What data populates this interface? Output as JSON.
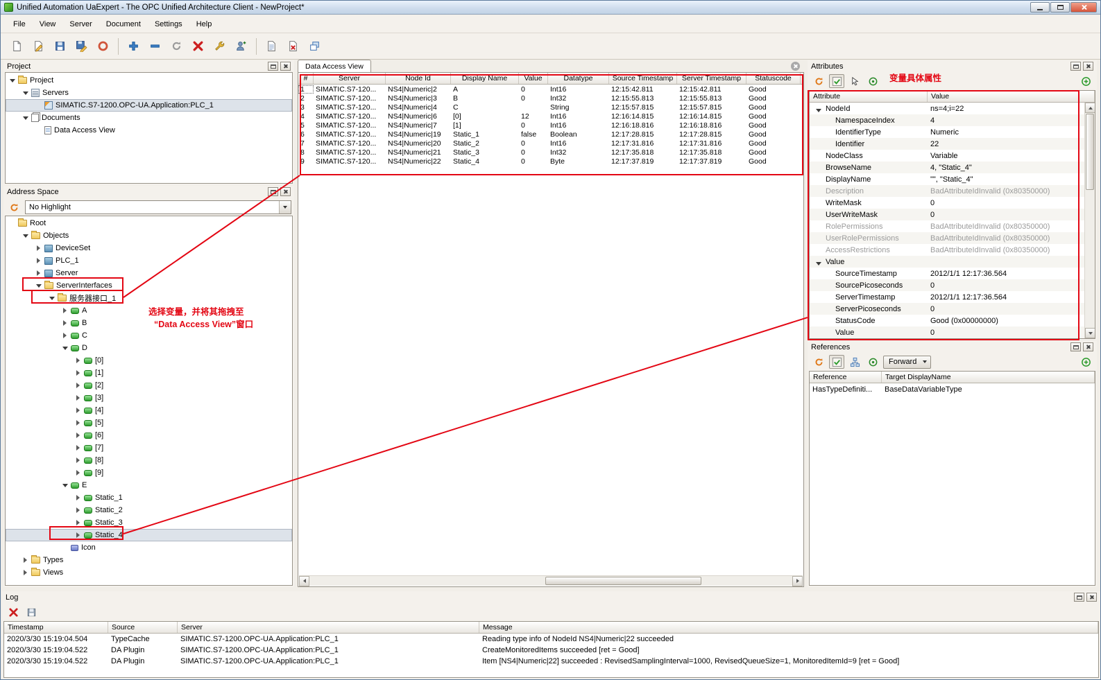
{
  "window": {
    "title": "Unified Automation UaExpert - The OPC Unified Architecture Client - NewProject*"
  },
  "menu": {
    "items": [
      "File",
      "View",
      "Server",
      "Document",
      "Settings",
      "Help"
    ]
  },
  "toolbar": {
    "icons": [
      "new-document",
      "open-document",
      "save",
      "save-as",
      "power-off",
      "add-server",
      "remove-server",
      "reconnect-server",
      "disconnect-server",
      "server-properties",
      "change-user",
      "add-document",
      "close-document",
      "window-layout"
    ]
  },
  "project_panel": {
    "title": "Project",
    "items": [
      {
        "level": 0,
        "exp": "open",
        "icon": "folder",
        "label": "Project"
      },
      {
        "level": 1,
        "exp": "open",
        "icon": "server",
        "label": "Servers"
      },
      {
        "level": 2,
        "exp": "none",
        "icon": "app",
        "label": "SIMATIC.S7-1200.OPC-UA.Application:PLC_1",
        "selected": true
      },
      {
        "level": 1,
        "exp": "open",
        "icon": "docs",
        "label": "Documents"
      },
      {
        "level": 2,
        "exp": "none",
        "icon": "doc",
        "label": "Data Access View"
      }
    ]
  },
  "address_space": {
    "title": "Address Space",
    "highlight_filter": "No Highlight",
    "items": [
      {
        "level": 0,
        "exp": "none",
        "icon": "folder",
        "label": "Root"
      },
      {
        "level": 1,
        "exp": "open",
        "icon": "folder",
        "label": "Objects"
      },
      {
        "level": 2,
        "exp": "closed",
        "icon": "cube",
        "label": "DeviceSet"
      },
      {
        "level": 2,
        "exp": "closed",
        "icon": "cube",
        "label": "PLC_1"
      },
      {
        "level": 2,
        "exp": "closed",
        "icon": "cube",
        "label": "Server"
      },
      {
        "level": 2,
        "exp": "open",
        "icon": "folder",
        "label": "ServerInterfaces"
      },
      {
        "level": 3,
        "exp": "open",
        "icon": "folder",
        "label": "服务器接口_1"
      },
      {
        "level": 4,
        "exp": "closed",
        "icon": "var",
        "label": "A"
      },
      {
        "level": 4,
        "exp": "closed",
        "icon": "var",
        "label": "B"
      },
      {
        "level": 4,
        "exp": "closed",
        "icon": "var",
        "label": "C"
      },
      {
        "level": 4,
        "exp": "open",
        "icon": "var",
        "label": "D"
      },
      {
        "level": 5,
        "exp": "closed",
        "icon": "var",
        "label": "[0]"
      },
      {
        "level": 5,
        "exp": "closed",
        "icon": "var",
        "label": "[1]"
      },
      {
        "level": 5,
        "exp": "closed",
        "icon": "var",
        "label": "[2]"
      },
      {
        "level": 5,
        "exp": "closed",
        "icon": "var",
        "label": "[3]"
      },
      {
        "level": 5,
        "exp": "closed",
        "icon": "var",
        "label": "[4]"
      },
      {
        "level": 5,
        "exp": "closed",
        "icon": "var",
        "label": "[5]"
      },
      {
        "level": 5,
        "exp": "closed",
        "icon": "var",
        "label": "[6]"
      },
      {
        "level": 5,
        "exp": "closed",
        "icon": "var",
        "label": "[7]"
      },
      {
        "level": 5,
        "exp": "closed",
        "icon": "var",
        "label": "[8]"
      },
      {
        "level": 5,
        "exp": "closed",
        "icon": "var",
        "label": "[9]"
      },
      {
        "level": 4,
        "exp": "open",
        "icon": "var",
        "label": "E"
      },
      {
        "level": 5,
        "exp": "closed",
        "icon": "var",
        "label": "Static_1"
      },
      {
        "level": 5,
        "exp": "closed",
        "icon": "var",
        "label": "Static_2"
      },
      {
        "level": 5,
        "exp": "closed",
        "icon": "var",
        "label": "Static_3"
      },
      {
        "level": 5,
        "exp": "closed",
        "icon": "var",
        "label": "Static_4",
        "selected": true
      },
      {
        "level": 4,
        "exp": "none",
        "icon": "prop",
        "label": "Icon"
      },
      {
        "level": 1,
        "exp": "closed",
        "icon": "folder",
        "label": "Types"
      },
      {
        "level": 1,
        "exp": "closed",
        "icon": "folder",
        "label": "Views"
      }
    ]
  },
  "dav": {
    "tab_title": "Data Access View",
    "columns": [
      "#",
      "Server",
      "Node Id",
      "Display Name",
      "Value",
      "Datatype",
      "Source Timestamp",
      "Server Timestamp",
      "Statuscode"
    ],
    "rows": [
      {
        "num": "1",
        "server": "SIMATIC.S7-120...",
        "node_id": "NS4|Numeric|2",
        "display_name": "A",
        "value": "0",
        "datatype": "Int16",
        "source_ts": "12:15:42.811",
        "server_ts": "12:15:42.811",
        "statuscode": "Good"
      },
      {
        "num": "2",
        "server": "SIMATIC.S7-120...",
        "node_id": "NS4|Numeric|3",
        "display_name": "B",
        "value": "0",
        "datatype": "Int32",
        "source_ts": "12:15:55.813",
        "server_ts": "12:15:55.813",
        "statuscode": "Good"
      },
      {
        "num": "3",
        "server": "SIMATIC.S7-120...",
        "node_id": "NS4|Numeric|4",
        "display_name": "C",
        "value": "",
        "datatype": "String",
        "source_ts": "12:15:57.815",
        "server_ts": "12:15:57.815",
        "statuscode": "Good"
      },
      {
        "num": "4",
        "server": "SIMATIC.S7-120...",
        "node_id": "NS4|Numeric|6",
        "display_name": "[0]",
        "value": "12",
        "datatype": "Int16",
        "source_ts": "12:16:14.815",
        "server_ts": "12:16:14.815",
        "statuscode": "Good"
      },
      {
        "num": "5",
        "server": "SIMATIC.S7-120...",
        "node_id": "NS4|Numeric|7",
        "display_name": "[1]",
        "value": "0",
        "datatype": "Int16",
        "source_ts": "12:16:18.816",
        "server_ts": "12:16:18.816",
        "statuscode": "Good"
      },
      {
        "num": "6",
        "server": "SIMATIC.S7-120...",
        "node_id": "NS4|Numeric|19",
        "display_name": "Static_1",
        "value": "false",
        "datatype": "Boolean",
        "source_ts": "12:17:28.815",
        "server_ts": "12:17:28.815",
        "statuscode": "Good"
      },
      {
        "num": "7",
        "server": "SIMATIC.S7-120...",
        "node_id": "NS4|Numeric|20",
        "display_name": "Static_2",
        "value": "0",
        "datatype": "Int16",
        "source_ts": "12:17:31.816",
        "server_ts": "12:17:31.816",
        "statuscode": "Good"
      },
      {
        "num": "8",
        "server": "SIMATIC.S7-120...",
        "node_id": "NS4|Numeric|21",
        "display_name": "Static_3",
        "value": "0",
        "datatype": "Int32",
        "source_ts": "12:17:35.818",
        "server_ts": "12:17:35.818",
        "statuscode": "Good"
      },
      {
        "num": "9",
        "server": "SIMATIC.S7-120...",
        "node_id": "NS4|Numeric|22",
        "display_name": "Static_4",
        "value": "0",
        "datatype": "Byte",
        "source_ts": "12:17:37.819",
        "server_ts": "12:17:37.819",
        "statuscode": "Good"
      }
    ]
  },
  "attributes": {
    "title": "Attributes",
    "columns": [
      "Attribute",
      "Value"
    ],
    "rows": [
      {
        "indent": 0,
        "expandable": true,
        "name": "NodeId",
        "value": "ns=4;i=22"
      },
      {
        "indent": 1,
        "name": "NamespaceIndex",
        "value": "4"
      },
      {
        "indent": 1,
        "name": "IdentifierType",
        "value": "Numeric"
      },
      {
        "indent": 1,
        "name": "Identifier",
        "value": "22"
      },
      {
        "indent": 0,
        "name": "NodeClass",
        "value": "Variable"
      },
      {
        "indent": 0,
        "name": "BrowseName",
        "value": "4, \"Static_4\""
      },
      {
        "indent": 0,
        "name": "DisplayName",
        "value": "\"\", \"Static_4\""
      },
      {
        "indent": 0,
        "name": "Description",
        "value": "BadAttributeIdInvalid (0x80350000)",
        "dim": true
      },
      {
        "indent": 0,
        "name": "WriteMask",
        "value": "0"
      },
      {
        "indent": 0,
        "name": "UserWriteMask",
        "value": "0"
      },
      {
        "indent": 0,
        "name": "RolePermissions",
        "value": "BadAttributeIdInvalid (0x80350000)",
        "dim": true
      },
      {
        "indent": 0,
        "name": "UserRolePermissions",
        "value": "BadAttributeIdInvalid (0x80350000)",
        "dim": true
      },
      {
        "indent": 0,
        "name": "AccessRestrictions",
        "value": "BadAttributeIdInvalid (0x80350000)",
        "dim": true
      },
      {
        "indent": 0,
        "expandable": true,
        "name": "Value",
        "value": ""
      },
      {
        "indent": 1,
        "name": "SourceTimestamp",
        "value": "2012/1/1 12:17:36.564"
      },
      {
        "indent": 1,
        "name": "SourcePicoseconds",
        "value": "0"
      },
      {
        "indent": 1,
        "name": "ServerTimestamp",
        "value": "2012/1/1 12:17:36.564"
      },
      {
        "indent": 1,
        "name": "ServerPicoseconds",
        "value": "0"
      },
      {
        "indent": 1,
        "name": "StatusCode",
        "value": "Good (0x00000000)"
      },
      {
        "indent": 1,
        "name": "Value",
        "value": "0"
      }
    ]
  },
  "references": {
    "title": "References",
    "direction": "Forward",
    "columns": [
      "Reference",
      "Target DisplayName"
    ],
    "rows": [
      {
        "reference": "HasTypeDefiniti...",
        "target": "BaseDataVariableType"
      }
    ]
  },
  "log": {
    "title": "Log",
    "columns": [
      "Timestamp",
      "Source",
      "Server",
      "Message"
    ],
    "rows": [
      {
        "timestamp": "2020/3/30 15:19:04.504",
        "source": "TypeCache",
        "server": "SIMATIC.S7-1200.OPC-UA.Application:PLC_1",
        "message": "Reading type info of NodeId NS4|Numeric|22 succeeded"
      },
      {
        "timestamp": "2020/3/30 15:19:04.522",
        "source": "DA Plugin",
        "server": "SIMATIC.S7-1200.OPC-UA.Application:PLC_1",
        "message": "CreateMonitoredItems succeeded [ret = Good]"
      },
      {
        "timestamp": "2020/3/30 15:19:04.522",
        "source": "DA Plugin",
        "server": "SIMATIC.S7-1200.OPC-UA.Application:PLC_1",
        "message": "Item [NS4|Numeric|22] succeeded : RevisedSamplingInterval=1000, RevisedQueueSize=1, MonitoredItemId=9 [ret = Good]"
      }
    ]
  },
  "annotations": {
    "attributes_label": "变量具体属性",
    "drag_hint_line1": "选择变量，并将其拖拽至",
    "drag_hint_line2": "“Data Access View”窗口"
  }
}
